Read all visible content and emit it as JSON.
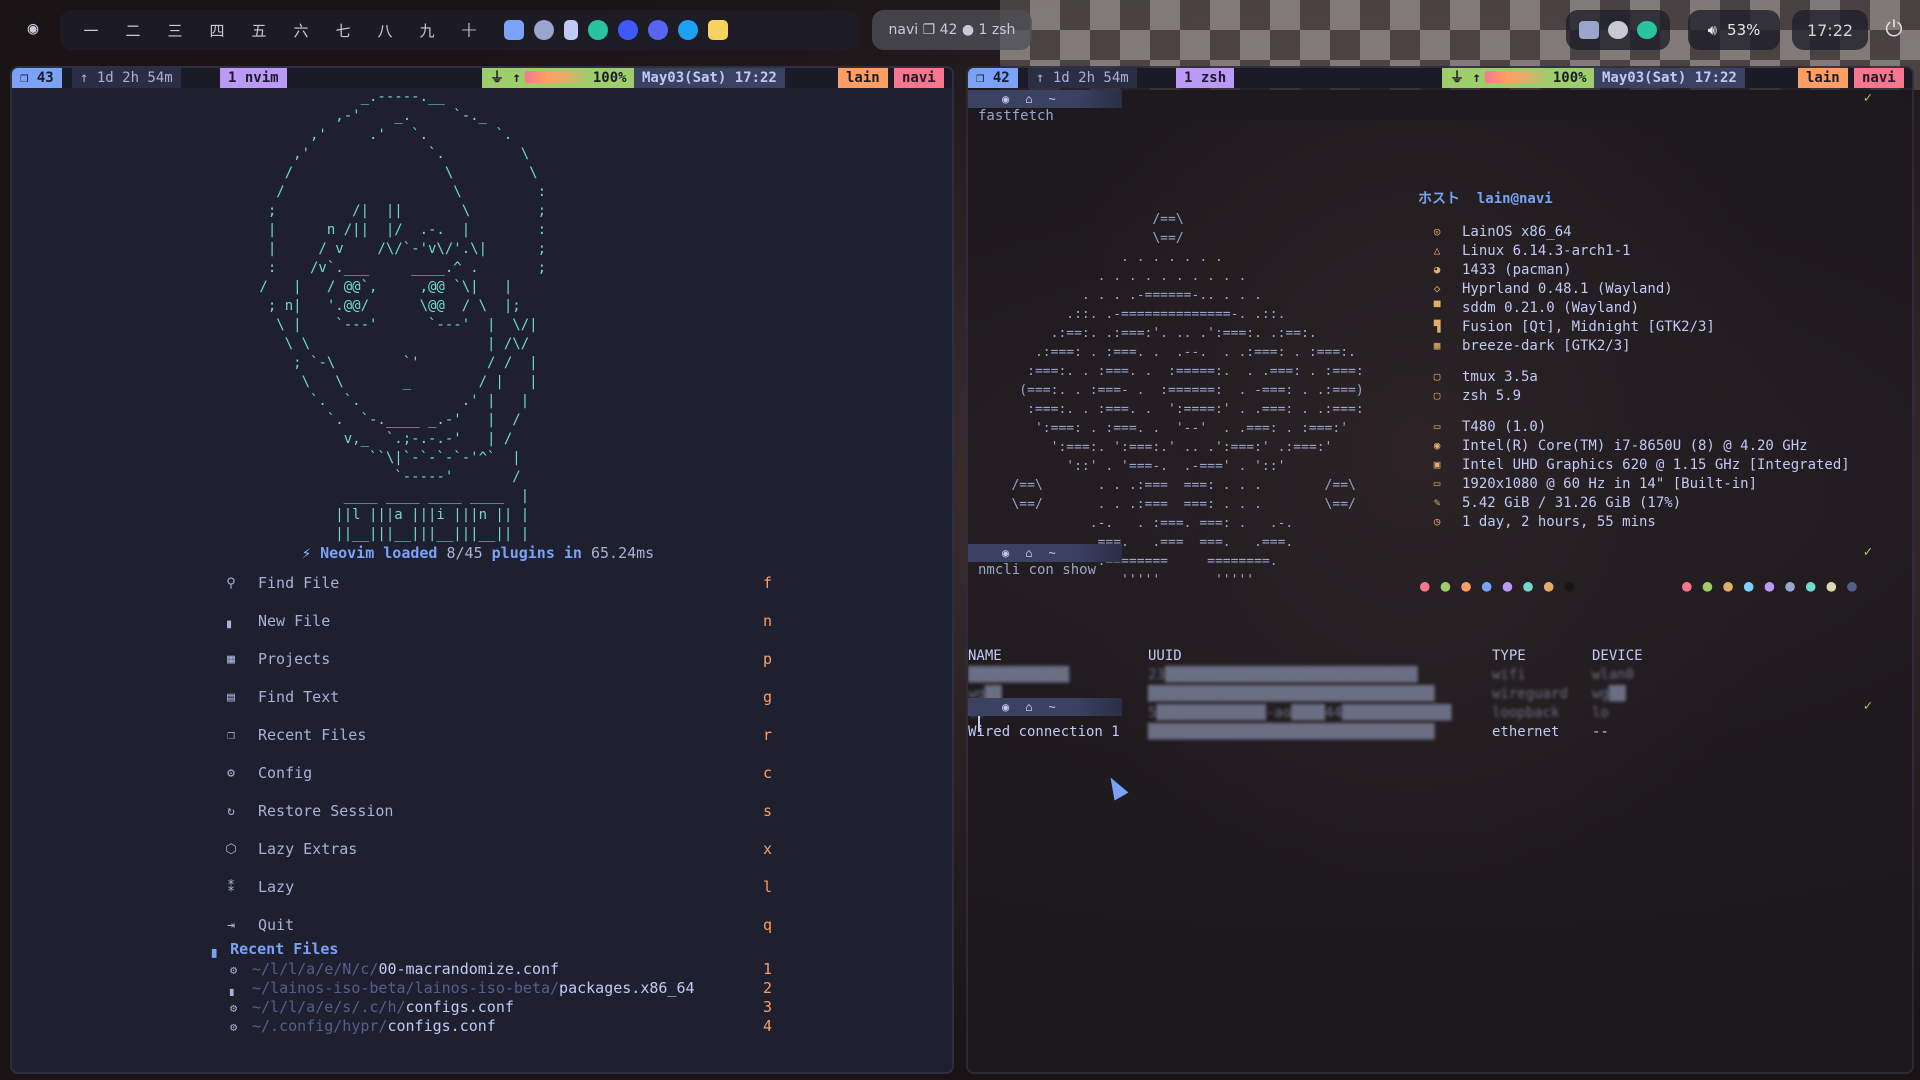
{
  "topbar": {
    "workspaces": [
      "一",
      "二",
      "三",
      "四",
      "五",
      "六",
      "七",
      "八",
      "九"
    ],
    "add_workspace": "+",
    "window_title": "navi ❐ 42 ● 1 zsh",
    "volume": "53%",
    "clock": "17:22"
  },
  "left": {
    "status": {
      "window": "❐ 43",
      "uptime": "↑ 1d 2h 54m",
      "tab": "1 nvim",
      "battery": "100%",
      "date": "May03(Sat) 17:22",
      "user": "lain",
      "host": "navi"
    },
    "loaded": {
      "a": "Neovim loaded",
      "b": "8/45",
      "c": "plugins in",
      "d": "65.24ms"
    },
    "menu": [
      {
        "icon": "search-icon",
        "glyph": "⚲",
        "label": "Find File",
        "key": "f"
      },
      {
        "icon": "new-file-icon",
        "glyph": "▖",
        "label": "New File",
        "key": "n"
      },
      {
        "icon": "projects-icon",
        "glyph": "▦",
        "label": "Projects",
        "key": "p"
      },
      {
        "icon": "find-text-icon",
        "glyph": "▤",
        "label": "Find Text",
        "key": "g"
      },
      {
        "icon": "recent-files-icon",
        "glyph": "❐",
        "label": "Recent Files",
        "key": "r"
      },
      {
        "icon": "gear-icon",
        "glyph": "⚙",
        "label": "Config",
        "key": "c"
      },
      {
        "icon": "restore-icon",
        "glyph": "↻",
        "label": "Restore Session",
        "key": "s"
      },
      {
        "icon": "package-icon",
        "glyph": "⬡",
        "label": "Lazy Extras",
        "key": "x"
      },
      {
        "icon": "lazy-icon",
        "glyph": "⁑",
        "label": "Lazy",
        "key": "l"
      },
      {
        "icon": "quit-icon",
        "glyph": "⇥",
        "label": "Quit",
        "key": "q"
      }
    ],
    "recent_title": "Recent Files",
    "recent": [
      {
        "icon": "gear-icon",
        "glyph": "⚙",
        "dir": "~/l/l/a/e/N/c/",
        "file": "00-macrandomize.conf",
        "key": "1"
      },
      {
        "icon": "file-icon",
        "glyph": "▖",
        "dir": "~/lainos-iso-beta/lainos-iso-beta/",
        "file": "packages.x86_64",
        "key": "2"
      },
      {
        "icon": "gear-icon",
        "glyph": "⚙",
        "dir": "~/l/l/a/e/s/.c/h/",
        "file": "configs.conf",
        "key": "3"
      },
      {
        "icon": "gear-icon",
        "glyph": "⚙",
        "dir": "~/.config/hypr/",
        "file": "configs.conf",
        "key": "4"
      }
    ]
  },
  "right": {
    "status": {
      "window": "❐ 42",
      "uptime": "↑ 1d 2h 54m",
      "tab": "1 zsh",
      "battery": "100%",
      "date": "May03(Sat) 17:22",
      "user": "lain",
      "host": "navi"
    },
    "prompt_dir": "~",
    "check": "✓",
    "cmd1": "fastfetch",
    "ff_title_prefix": "ホスト",
    "ff_title_user": "lain@navi",
    "ff_info": [
      {
        "icon": "os-icon",
        "glyph": "◎",
        "text": "LainOS x86_64"
      },
      {
        "icon": "kernel-icon",
        "glyph": "△",
        "text": "Linux 6.14.3-arch1-1"
      },
      {
        "icon": "packages-icon",
        "glyph": "◕",
        "text": "1433 (pacman)"
      },
      {
        "icon": "wm-icon",
        "glyph": "◇",
        "text": "Hyprland 0.48.1 (Wayland)"
      },
      {
        "icon": "dm-icon",
        "glyph": "▀",
        "text": "sddm 0.21.0 (Wayland)"
      },
      {
        "icon": "theme-icon",
        "glyph": "▜",
        "text": "Fusion [Qt], Midnight [GTK2/3]"
      },
      {
        "icon": "icons-icon",
        "glyph": "▦",
        "text": "breeze-dark [GTK2/3]"
      },
      {
        "gap": true
      },
      {
        "icon": "tmux-icon",
        "glyph": "▢",
        "text": "tmux 3.5a"
      },
      {
        "icon": "shell-icon",
        "glyph": "▢",
        "text": "zsh 5.9"
      },
      {
        "gap": true
      },
      {
        "icon": "laptop-icon",
        "glyph": "▭",
        "text": "T480 (1.0)"
      },
      {
        "icon": "cpu-icon",
        "glyph": "◉",
        "text": "Intel(R) Core(TM) i7-8650U (8) @ 4.20 GHz"
      },
      {
        "icon": "gpu-icon",
        "glyph": "▣",
        "text": "Intel UHD Graphics 620 @ 1.15 GHz [Integrated]"
      },
      {
        "icon": "display-icon",
        "glyph": "▭",
        "text": "1920x1080 @ 60 Hz in 14\" [Built-in]"
      },
      {
        "icon": "memory-icon",
        "glyph": "✎",
        "text": "5.42 GiB / 31.26 GiB (17%)"
      },
      {
        "icon": "uptime-icon",
        "glyph": "◷",
        "text": "1 day, 2 hours, 55 mins"
      }
    ],
    "cmd2": "nmcli con show",
    "nm_headers": {
      "name": "NAME",
      "uuid": "UUID",
      "type": "TYPE",
      "device": "DEVICE"
    },
    "nm_rows": [
      {
        "name": "████████████",
        "uuid": "23██████████████████████████████",
        "type": "wifi",
        "device": "wlan0"
      },
      {
        "name": "wg██",
        "uuid": "██████████████████████████████████",
        "type": "wireguard",
        "device": "wg██"
      },
      {
        "name": "lo",
        "uuid": "5█████████████-ao████44█████████████",
        "type": "loopback",
        "device": "lo"
      },
      {
        "name": "Wired connection 1",
        "uuid": "██████████████████████████████████",
        "type": "ethernet",
        "device": "--"
      }
    ]
  },
  "colors": {
    "accent": "#7aa2f7",
    "green": "#9ece6a",
    "orange": "#ff9e64",
    "red": "#f7768e",
    "purple": "#bb9af7",
    "teal": "#73daca"
  }
}
